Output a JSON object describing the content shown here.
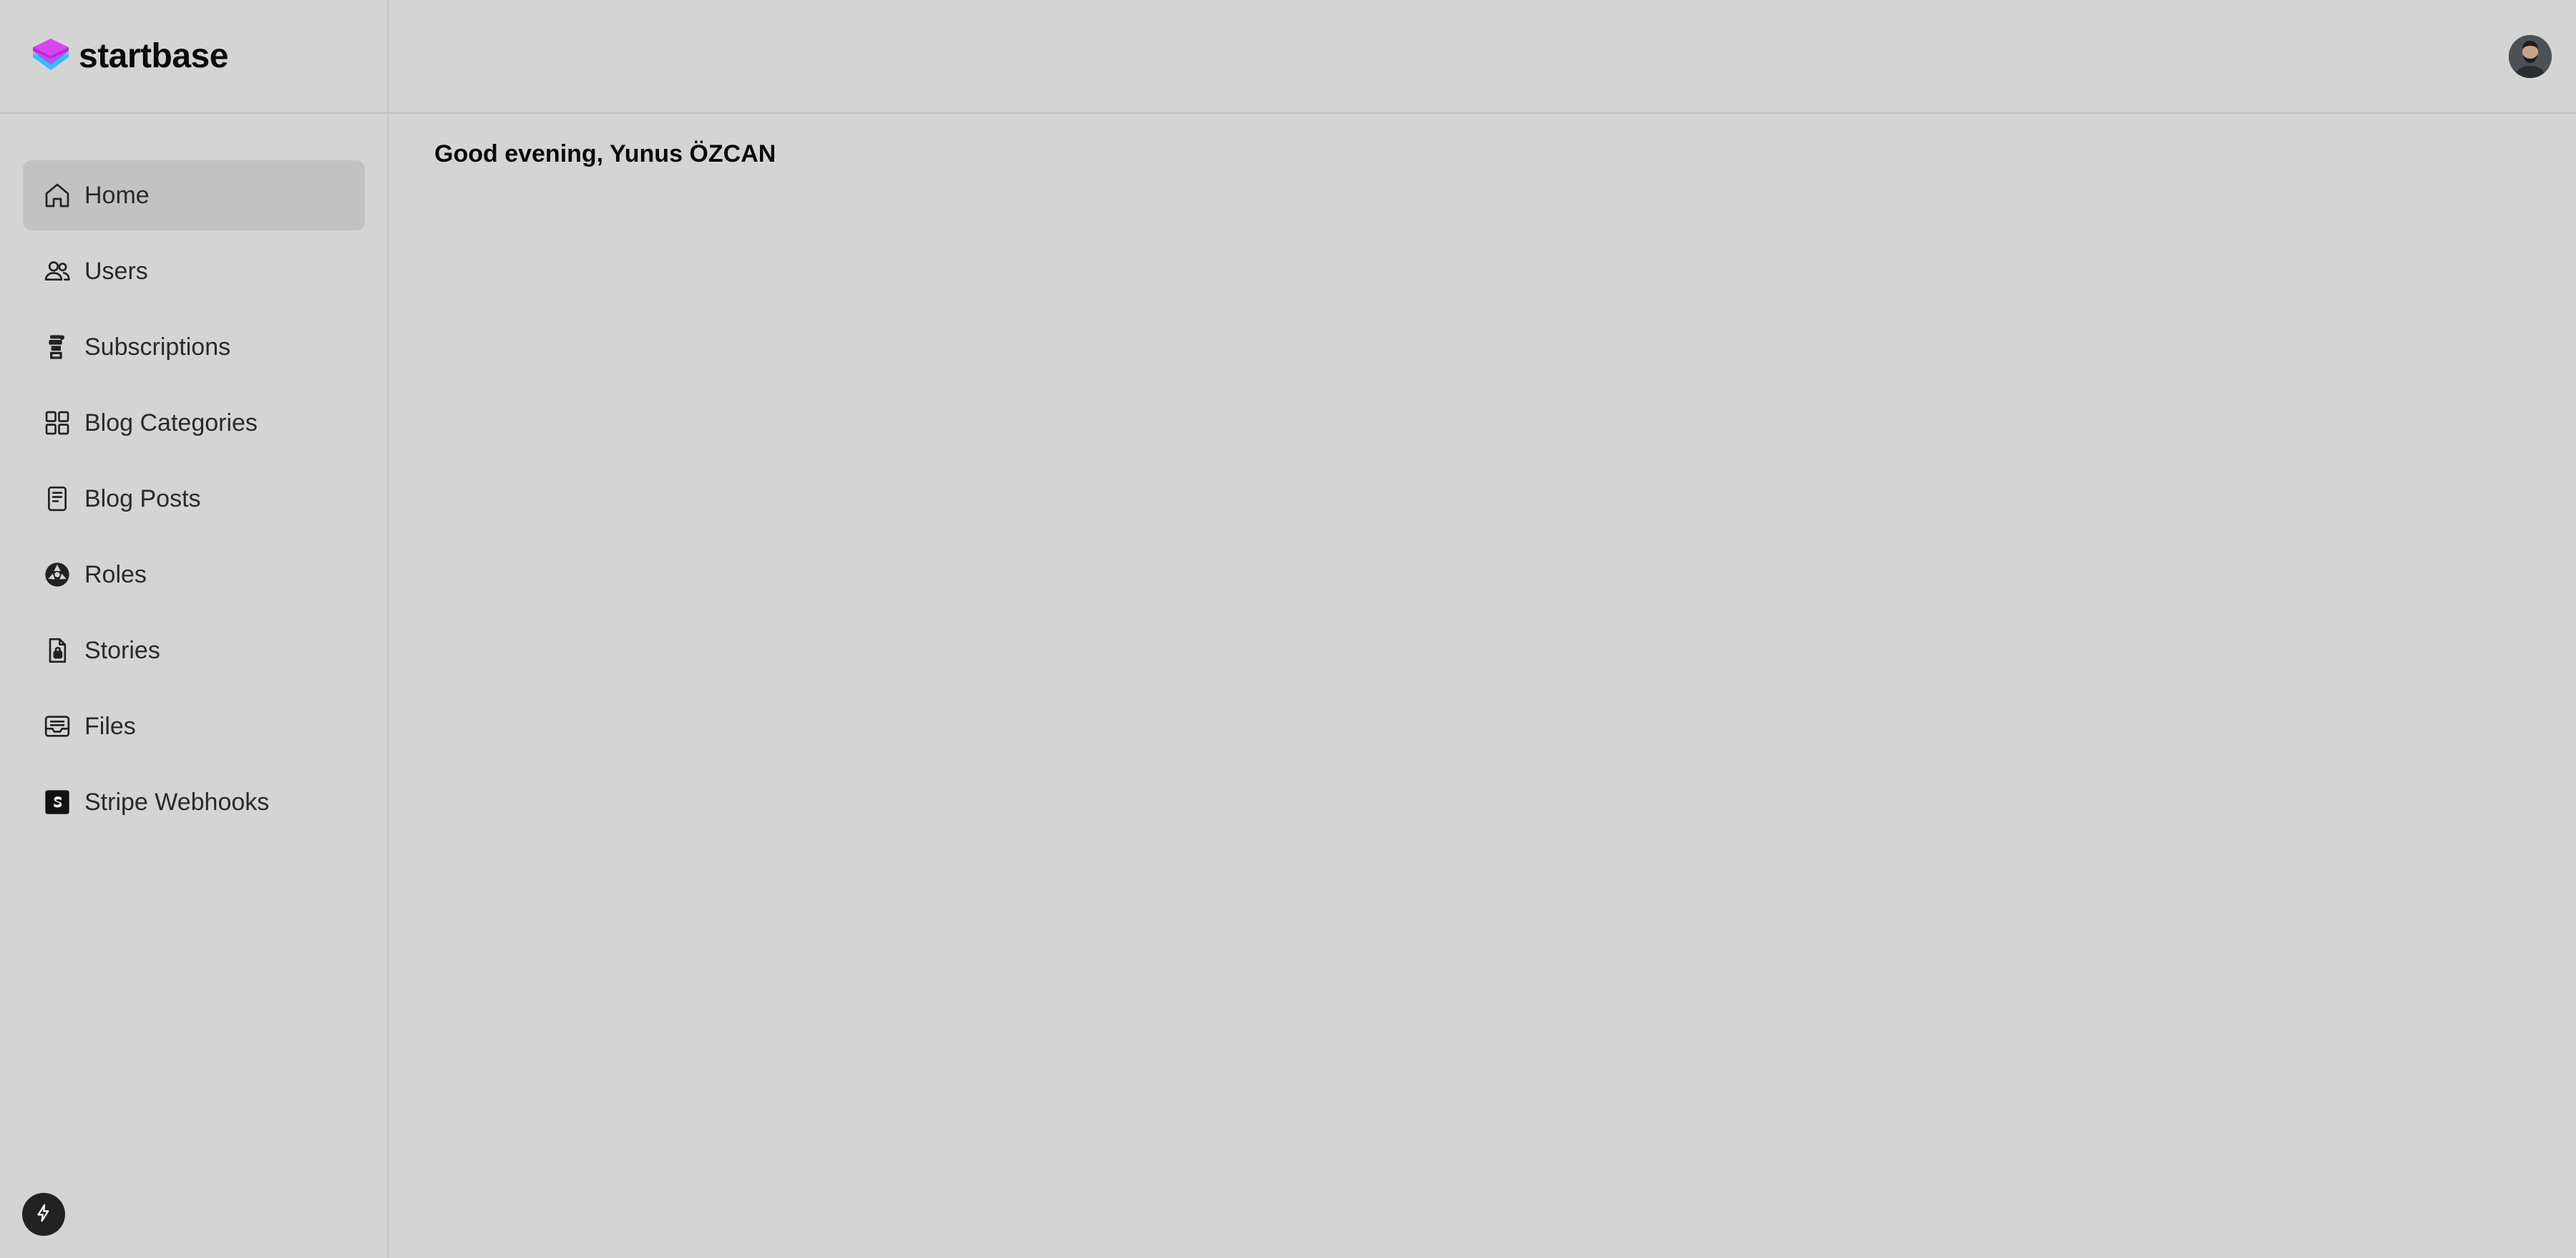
{
  "brand": {
    "name": "startbase",
    "logo_icon": "layers-stack-icon",
    "logo_colors": [
      "#d946ef",
      "#a855f7",
      "#38bdf8"
    ]
  },
  "nav": {
    "items": [
      {
        "label": "Home",
        "icon": "home-icon",
        "active": true
      },
      {
        "label": "Users",
        "icon": "users-icon",
        "active": false
      },
      {
        "label": "Subscriptions",
        "icon": "subscriptions-icon",
        "active": false
      },
      {
        "label": "Blog Categories",
        "icon": "grid-icon",
        "active": false
      },
      {
        "label": "Blog Posts",
        "icon": "document-icon",
        "active": false
      },
      {
        "label": "Roles",
        "icon": "roles-icon",
        "active": false
      },
      {
        "label": "Stories",
        "icon": "file-lock-icon",
        "active": false
      },
      {
        "label": "Files",
        "icon": "inbox-icon",
        "active": false
      },
      {
        "label": "Stripe Webhooks",
        "icon": "stripe-icon",
        "active": false
      }
    ]
  },
  "footer": {
    "action_icon": "bolt-icon"
  },
  "header": {
    "avatar_icon": "user-avatar"
  },
  "main": {
    "greeting": "Good evening, Yunus ÖZCAN"
  },
  "colors": {
    "background": "#d4d4d4",
    "active_item": "#c2c2c2",
    "border": "#c2c2c2"
  }
}
